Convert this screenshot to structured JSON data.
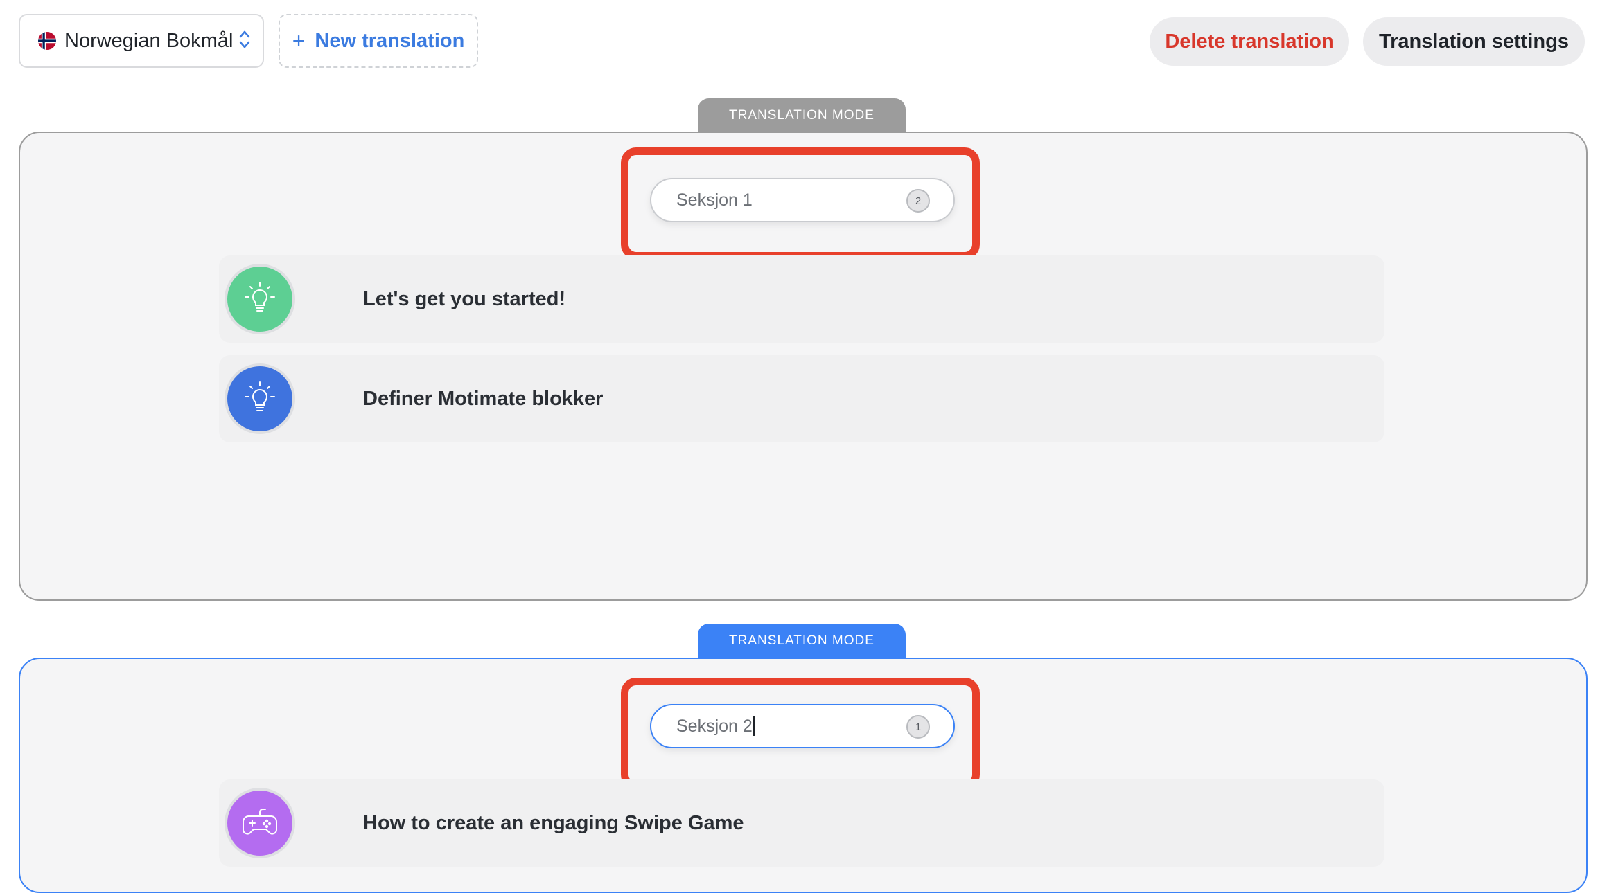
{
  "toolbar": {
    "language": "Norwegian Bokmål",
    "new_translation_label": "New translation",
    "plus_symbol": "+",
    "delete_translation_label": "Delete translation",
    "translation_settings_label": "Translation settings"
  },
  "sections": [
    {
      "mode_label": "TRANSLATION MODE",
      "title_value": "Seksjon 1",
      "item_count": "2",
      "items": [
        {
          "title": "Let's get you started!",
          "icon": "lightbulb-icon",
          "color": "#5dcf93"
        },
        {
          "title": "Definer Motimate blokker",
          "icon": "lightbulb-icon",
          "color": "#3f73de"
        }
      ]
    },
    {
      "mode_label": "TRANSLATION MODE",
      "title_value": "Seksjon 2",
      "item_count": "1",
      "items": [
        {
          "title": "How to create an engaging Swipe Game",
          "icon": "gamepad-icon",
          "color": "#b46cf0"
        }
      ]
    }
  ],
  "colors": {
    "accent_blue": "#3b82f6",
    "delete_red": "#d8372b",
    "highlight_red": "#e8402b"
  }
}
